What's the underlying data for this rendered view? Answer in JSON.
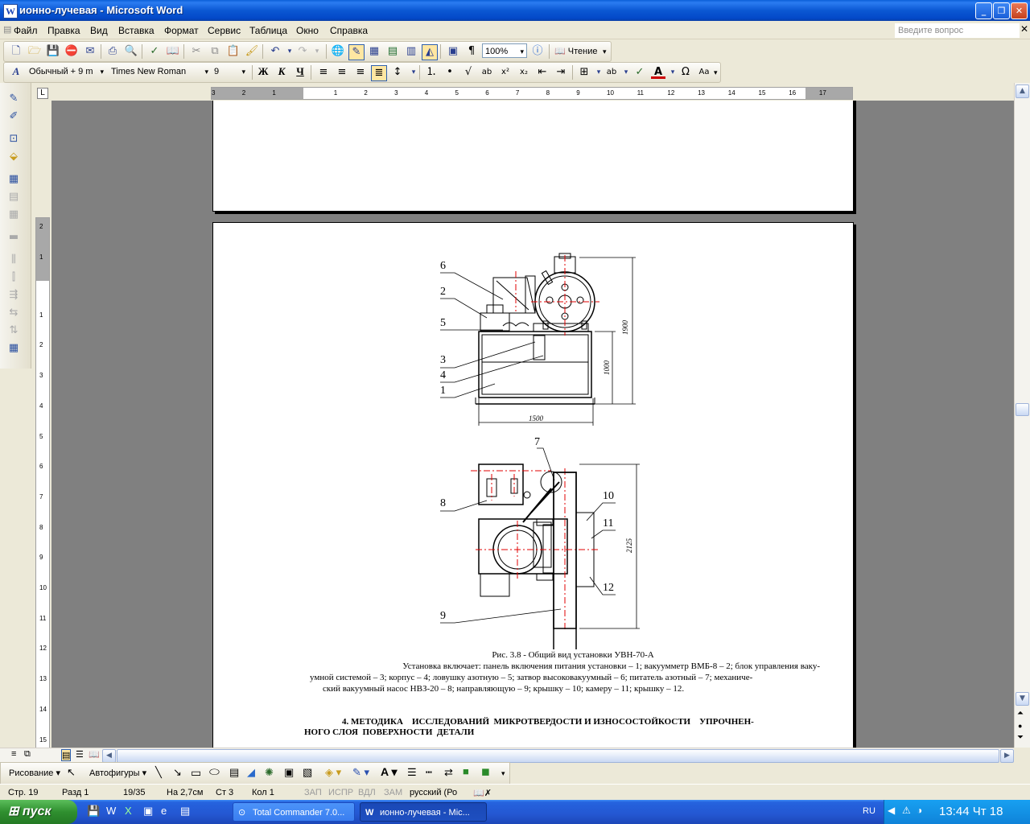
{
  "window": {
    "title": "ионно-лучевая - Microsoft Word",
    "app_icon_letter": "W"
  },
  "menu": {
    "items": [
      "Файл",
      "Правка",
      "Вид",
      "Вставка",
      "Формат",
      "Сервис",
      "Таблица",
      "Окно",
      "Справка"
    ],
    "help_placeholder": "Введите вопрос"
  },
  "toolbar_standard": {
    "zoom": "100%",
    "reading_label": "Чтение"
  },
  "toolbar_format": {
    "style": "Обычный + 9 m",
    "font": "Times New Roman",
    "size": "9"
  },
  "ruler": {
    "h_labels": [
      "3",
      "2",
      "1",
      "1",
      "2",
      "3",
      "4",
      "5",
      "6",
      "7",
      "8",
      "9",
      "10",
      "11",
      "12",
      "13",
      "14",
      "15",
      "16",
      "17"
    ],
    "v_labels": [
      "2",
      "1",
      "1",
      "2",
      "3",
      "4",
      "5",
      "6",
      "7",
      "8",
      "9",
      "10",
      "11",
      "12",
      "13",
      "14",
      "15"
    ]
  },
  "figure": {
    "upper_callouts": [
      "6",
      "2",
      "5",
      "3",
      "4",
      "1"
    ],
    "upper_dims": {
      "height_total": "1900",
      "height_body": "1000",
      "width": "1500"
    },
    "lower_callouts": [
      "7",
      "8",
      "10",
      "11",
      "12",
      "9"
    ],
    "lower_dims": {
      "height_total": "2125"
    },
    "caption": "Рис. 3.8 - Общий вид установки УВН-70-А",
    "desc_lines": [
      "Установка включает: панель включения питания установки – 1; вакуумметр ВМБ-8 – 2; блок управления ваку-",
      "умной системой – 3; корпус – 4; ловушку азотную – 5; затвор высоковакуумный – 6; питатель азотный – 7; механиче-",
      "ский вакуумный насос НВЗ-20 – 8; направляющую – 9; крышку – 10; камеру – 11; крышку – 12."
    ]
  },
  "heading": {
    "line1": "4. МЕТОДИКА    ИССЛЕДОВАНИЙ  МИКРОТВЕРДОСТИ И ИЗНОСОСТОЙКОСТИ    УПРОЧНЕН-",
    "line2": "НОГО СЛОЯ  ПОВЕРХНОСТИ  ДЕТАЛИ"
  },
  "drawbar": {
    "draw_label": "Рисование",
    "autoshapes_label": "Автофигуры"
  },
  "status": {
    "page": "Стр. 19",
    "section": "Разд 1",
    "pages": "19/35",
    "at": "На 2,7см",
    "line": "Ст 3",
    "col": "Кол 1",
    "rec": "ЗАП",
    "trk": "ИСПР",
    "ext": "ВДЛ",
    "ovr": "ЗАМ",
    "lang": "русский (Ро"
  },
  "taskbar": {
    "start": "пуск",
    "tasks": [
      {
        "label": "Total Commander 7.0..."
      },
      {
        "label": "ионно-лучевая - Mic..."
      }
    ],
    "lang": "RU",
    "clock": "13:44 Чт 18"
  }
}
